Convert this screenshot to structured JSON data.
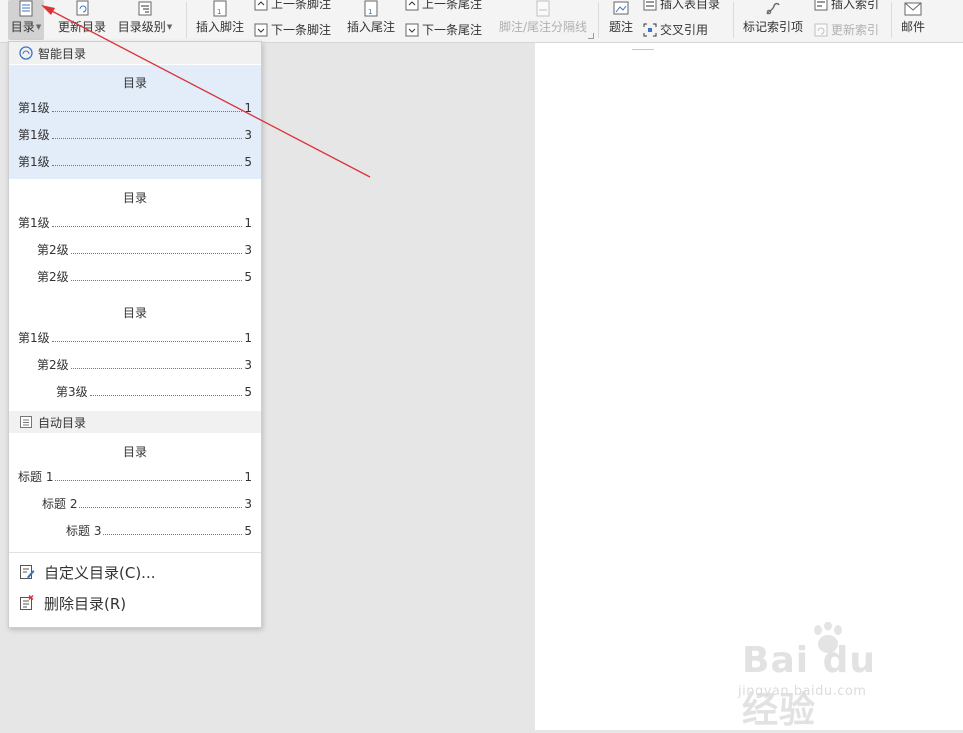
{
  "ribbon": {
    "toc_label": "目录",
    "update_toc": "更新目录",
    "toc_level": "目录级别",
    "insert_footnote": "插入脚注",
    "prev_footnote": "上一条脚注",
    "next_footnote": "下一条脚注",
    "insert_endnote": "插入尾注",
    "prev_endnote": "上一条尾注",
    "next_endnote": "下一条尾注",
    "footnote_separator": "脚注/尾注分隔线",
    "caption": "题注",
    "insert_table_of_figures": "插入表目录",
    "cross_reference": "交叉引用",
    "mark_index_entry": "标记索引项",
    "insert_index": "插入索引",
    "update_index": "更新索引",
    "mail": "邮件"
  },
  "dropdown": {
    "smart_toc_header": "智能目录",
    "auto_toc_header": "自动目录",
    "smart_styles": [
      {
        "title": "目录",
        "entries": [
          {
            "label": "第1级",
            "page": "1"
          },
          {
            "label": "第1级",
            "page": "3"
          },
          {
            "label": "第1级",
            "page": "5"
          }
        ]
      },
      {
        "title": "目录",
        "entries": [
          {
            "label": "第1级",
            "page": "1"
          },
          {
            "label": "第2级",
            "page": "3"
          },
          {
            "label": "第2级",
            "page": "5"
          }
        ]
      },
      {
        "title": "目录",
        "entries": [
          {
            "label": "第1级",
            "page": "1"
          },
          {
            "label": "第2级",
            "page": "3"
          },
          {
            "label": "第3级",
            "page": "5"
          }
        ]
      }
    ],
    "auto_style": {
      "title": "目录",
      "entries": [
        {
          "label": "标题 1",
          "page": "1"
        },
        {
          "label": "标题 2",
          "page": "3"
        },
        {
          "label": "标题 3",
          "page": "5"
        }
      ]
    },
    "custom_toc": "自定义目录(C)...",
    "delete_toc": "删除目录(R)"
  },
  "watermark": {
    "brand": "Bai du 经验",
    "url": "jingyan.baidu.com"
  },
  "colors": {
    "annotation_arrow": "#d9343a",
    "selected_block": "#e3ecf9",
    "icon_blue": "#3b73c8"
  }
}
